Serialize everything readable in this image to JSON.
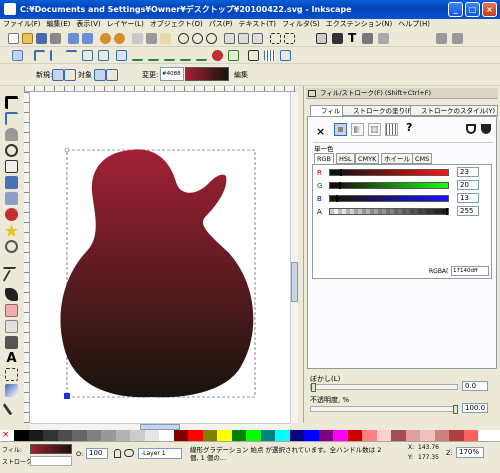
{
  "window": {
    "title": "C:¥Documents and Settings¥Owner¥デスクトップ¥20100422.svg - Inkscape",
    "min": "_",
    "max": "□",
    "close": "×"
  },
  "menu": [
    "ファイル(F)",
    "編集(E)",
    "表示(V)",
    "レイヤー(L)",
    "オブジェクト(O)",
    "パス(P)",
    "テキスト(T)",
    "フィルタ(S)",
    "エクステンション(N)",
    "ヘルプ(H)"
  ],
  "gradient_bar": {
    "new_label": "新規:",
    "on_label": "対象",
    "change_label": "変更:",
    "gradient_id": "#4088",
    "edit_label": "編集"
  },
  "panel": {
    "title": "フィル/ストローク(F) (Shift+Ctrl+F)",
    "tabs": [
      "フィル",
      "ストロークの塗り(P)",
      "ストロークのスタイル(Y)"
    ],
    "paint_unknown": "?",
    "single_color": "単一色",
    "color_tabs": [
      "RGB",
      "HSL",
      "CMYK",
      "ホイール",
      "CMS"
    ],
    "channels": [
      {
        "label": "R",
        "value": "23"
      },
      {
        "label": "G",
        "value": "20"
      },
      {
        "label": "B",
        "value": "13"
      },
      {
        "label": "A",
        "value": "255"
      }
    ],
    "rgba_label": "RGBA(",
    "rgba_value": "17140dff",
    "blur_label": "ぼかし(L)",
    "blur_value": "0.0",
    "opacity_label": "不透明度, %",
    "opacity_value": "100.0"
  },
  "status": {
    "fill_label": "フィル:",
    "stroke_label": "ストローク:",
    "opacity_label": "O:",
    "opacity_value": "100",
    "layer": "-Layer 1",
    "message": "線形グラデーション 始点 が選択されています。全ハンドル数は 2 個, 1 個の...",
    "x_label": "X:",
    "x_value": "143.76",
    "y_label": "Y:",
    "y_value": "177.35",
    "zoom_label": "Z:",
    "zoom_value": "170%"
  },
  "colors": {
    "gradient_top": "#a32136",
    "gradient_bottom": "#17140d",
    "title_blue": "#0a5fd8"
  }
}
